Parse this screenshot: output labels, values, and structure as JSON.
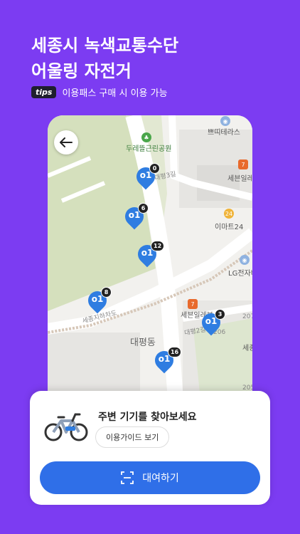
{
  "header": {
    "line1": "세종시 녹색교통수단",
    "line2": "어울링 자전거",
    "tips_badge": "tips",
    "tips_text": "이용패스 구매 시 이용 가능"
  },
  "map": {
    "labels": {
      "park": "두레뜰근린공원",
      "terrace": "쁘띠테라스",
      "seven1": "세븐일레",
      "emart": "이마트24",
      "lg": "LG전자베",
      "seven2": "세븐일레븐",
      "district": "대평동",
      "underpass": "세종지하차도",
      "road3": "대평3길",
      "road2": "대평2길",
      "num207": "207",
      "num206": "206",
      "num205": "205",
      "sejong": "세종"
    },
    "pins": [
      {
        "count": "0"
      },
      {
        "count": "6"
      },
      {
        "count": "12"
      },
      {
        "count": "8"
      },
      {
        "count": "3"
      },
      {
        "count": "16"
      }
    ],
    "pin_logo": "o1",
    "poi_glyphs": {
      "terrace": "◉",
      "seven": "7",
      "emart": "24"
    }
  },
  "sheet": {
    "title": "주변 기기를 찾아보세요",
    "guide_button": "이용가이드 보기",
    "rent_button": "대여하기"
  },
  "colors": {
    "accent": "#7c3cf2",
    "primary": "#2f6fe8",
    "pin": "#2f7de1"
  }
}
